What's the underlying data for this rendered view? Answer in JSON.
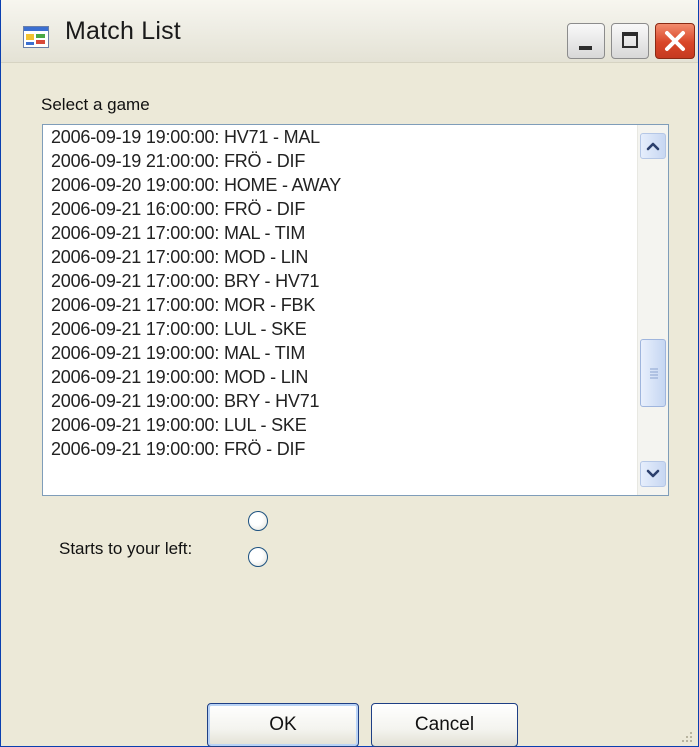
{
  "window": {
    "title": "Match List"
  },
  "list": {
    "label": "Select a game",
    "items": [
      "2006-09-19 19:00:00: HV71 - MAL",
      "2006-09-19 21:00:00: FRÖ - DIF",
      "2006-09-20 19:00:00: HOME - AWAY",
      "2006-09-21 16:00:00: FRÖ - DIF",
      "2006-09-21 17:00:00: MAL - TIM",
      "2006-09-21 17:00:00: MOD - LIN",
      "2006-09-21 17:00:00: BRY - HV71",
      "2006-09-21 17:00:00: MOR - FBK",
      "2006-09-21 17:00:00: LUL - SKE",
      "2006-09-21 19:00:00: MAL - TIM",
      "2006-09-21 19:00:00: MOD - LIN",
      "2006-09-21 19:00:00: BRY - HV71",
      "2006-09-21 19:00:00: LUL - SKE",
      "2006-09-21 19:00:00: FRÖ - DIF"
    ]
  },
  "starts": {
    "label": "Starts to your left:"
  },
  "buttons": {
    "ok": "OK",
    "cancel": "Cancel"
  },
  "colors": {
    "window_bg": "#ece9d8",
    "close_button": "#d94628",
    "border": "#0a3fb0"
  }
}
